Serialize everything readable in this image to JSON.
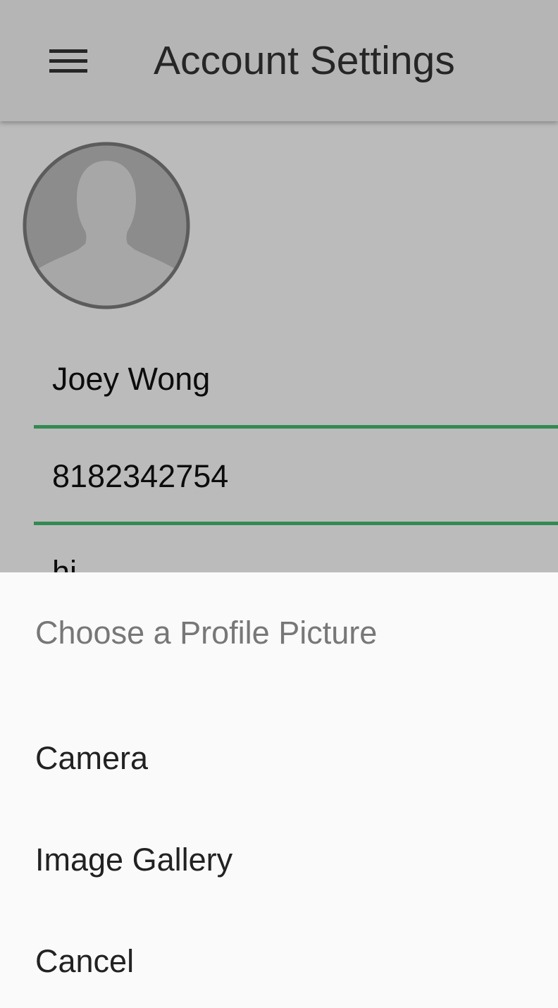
{
  "toolbar": {
    "menu_icon": "hamburger-menu-icon",
    "title": "Account Settings"
  },
  "profile": {
    "avatar_icon": "person-silhouette-icon",
    "name": "Joey Wong",
    "phone": "8182342754",
    "bio": "hi"
  },
  "dialog": {
    "title": "Choose a Profile Picture",
    "options": [
      {
        "label": "Camera"
      },
      {
        "label": "Image Gallery"
      },
      {
        "label": "Cancel"
      }
    ]
  },
  "colors": {
    "accent": "#43b66a",
    "toolbar": "#eeeeee",
    "scrim": "rgba(0,0,0,0.24)"
  }
}
